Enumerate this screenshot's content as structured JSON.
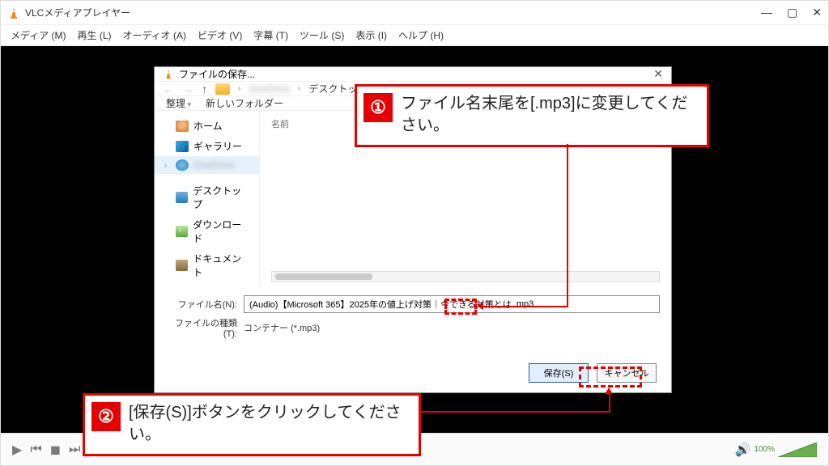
{
  "app": {
    "title": "VLCメディアプレイヤー",
    "menu": [
      "メディア (M)",
      "再生 (L)",
      "オーディオ (A)",
      "ビデオ (V)",
      "字幕 (T)",
      "ツール (S)",
      "表示 (I)",
      "ヘルプ (H)"
    ]
  },
  "dialog": {
    "title": "ファイルの保存...",
    "breadcrumb": {
      "hidden": "OneDrive",
      "part": "デスクトップ"
    },
    "toolbar": {
      "organize": "整理",
      "newfolder": "新しいフォルダー"
    },
    "nav": {
      "home": "ホーム",
      "gallery": "ギャラリー",
      "onedrive": "OneDrive",
      "desktop": "デスクトップ",
      "downloads": "ダウンロード",
      "documents": "ドキュメント"
    },
    "list": {
      "col_name": "名前"
    },
    "fields": {
      "name_label": "ファイル名(N):",
      "name_value_pre": "(Audio)【Microsoft 365】2025年の値上げ対策｜今できる対策とは",
      "name_value_ext": ".mp3",
      "type_label": "ファイルの種類(T):",
      "type_value": "コンテナー (*.mp3)"
    },
    "buttons": {
      "save": "保存(S)",
      "cancel": "キャンセル"
    }
  },
  "callouts": {
    "c1": "ファイル名末尾を[.mp3]に変更してください。",
    "c2": "[保存(S)]ボタンをクリックしてください。",
    "n1": "①",
    "n2": "②"
  },
  "volume": {
    "pct": "100%"
  }
}
